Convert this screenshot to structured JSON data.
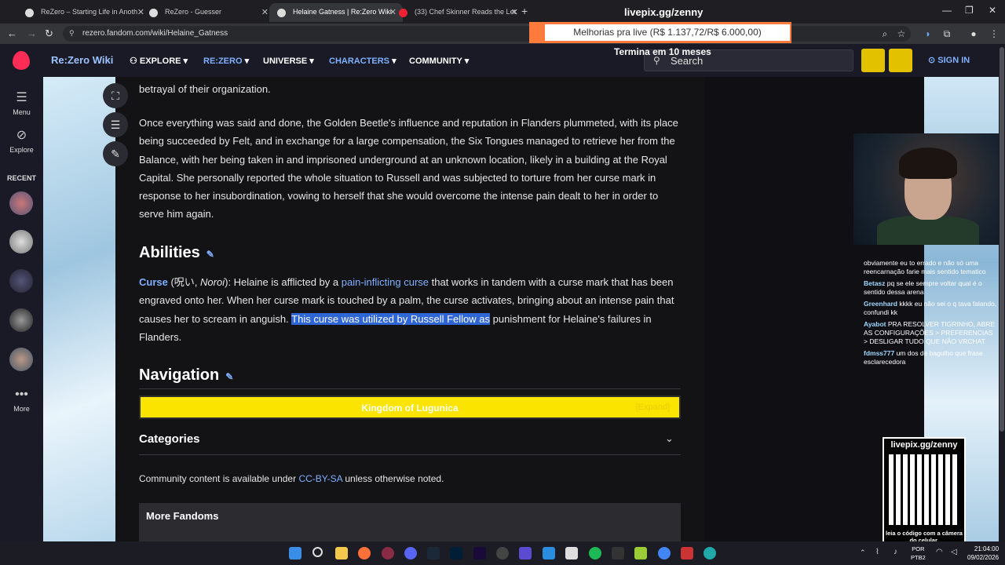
{
  "browser": {
    "tabs": [
      {
        "title": "ReZero – Starting Life in Anoth",
        "active": false
      },
      {
        "title": "ReZero - Guesser",
        "active": false
      },
      {
        "title": "Helaine Gatness | Re:Zero Wiki",
        "active": true
      },
      {
        "title": "(33) Chef Skinner Reads the Let",
        "active": false
      }
    ],
    "url": "rezero.fandom.com/wiki/Helaine_Gatness"
  },
  "overlay": {
    "livepix_top": "livepix.gg/zenny",
    "banner": "Melhorias pra live (R$ 1.137,72/R$ 6.000,00)",
    "timer": "Termina em 10 meses",
    "qr_top": "livepix.gg/zenny",
    "qr_bottom": "leia o código com a câmera do celular."
  },
  "wiki": {
    "name": "Re:Zero Wiki",
    "nav": [
      "EXPLORE",
      "RE:ZERO",
      "UNIVERSE",
      "CHARACTERS",
      "COMMUNITY"
    ],
    "search_placeholder": "Search",
    "sign_in": "SIGN IN"
  },
  "sidebar": {
    "menu": "Menu",
    "explore": "Explore",
    "recent": "RECENT",
    "more": "More"
  },
  "article": {
    "p0": "betrayal of their organization.",
    "p1": "Once everything was said and done, the Golden Beetle's influence and reputation in Flanders plummeted, with its place being succeeded by Felt, and in exchange for a large compensation, the Six Tongues managed to retrieve her from the Balance, with her being taken in and imprisoned underground at an unknown location, likely in a building at the Royal Capital. She personally reported the whole situation to Russell and was subjected to torture from her curse mark in response to her insubordination, vowing to herself that she would overcome the intense pain dealt to her in order to serve him again.",
    "abilities_heading": "Abilities",
    "curse_link": "Curse",
    "curse_jp": " (呪い, ",
    "curse_romaji": "Noroi",
    "curse_text1": "): Helaine is afflicted by a ",
    "curse_link2": "pain-inflicting curse",
    "curse_text2": " that works in tandem with a curse mark that has been engraved onto her. When her curse mark is touched by a palm, the curse activates, bringing about an intense pain that causes her to scream in anguish. ",
    "curse_highlight": "This curse was utilized by Russell Fellow as",
    "curse_text3": " punishment for Helaine's failures in Flanders.",
    "navigation_heading": "Navigation",
    "navbox_title": "Kingdom of Lugunica",
    "navbox_expand": "[Expand]",
    "categories": "Categories",
    "license_pre": "Community content is available under ",
    "license_link": "CC-BY-SA",
    "license_post": " unless otherwise noted.",
    "more_fandoms": "More Fandoms"
  },
  "chat": [
    {
      "user": "",
      "text": "obviamente eu to errado e não só uma reencarnação farie mais sentido tematico"
    },
    {
      "user": "Betasz",
      "text": " pq se ele sempre voltar qual é o sentido dessa arena"
    },
    {
      "user": "Greenhard",
      "text": " kkkk eu não sei o q tava falando, confundi kk"
    },
    {
      "user": "Ayabot",
      "text": " PRA RESOLVER TIGRINHO, ABRE AS CONFIGURAÇÕES > PREFERENCIAS > DESLIGAR TUDO QUE NÃO VRCHAT"
    },
    {
      "user": "fdmss777",
      "text": " um dos de bagulho que frase esclarecedora"
    }
  ],
  "taskbar": {
    "lang1": "POR",
    "lang2": "PTB2",
    "time": "21:04:00",
    "date": "09/02/2026"
  }
}
